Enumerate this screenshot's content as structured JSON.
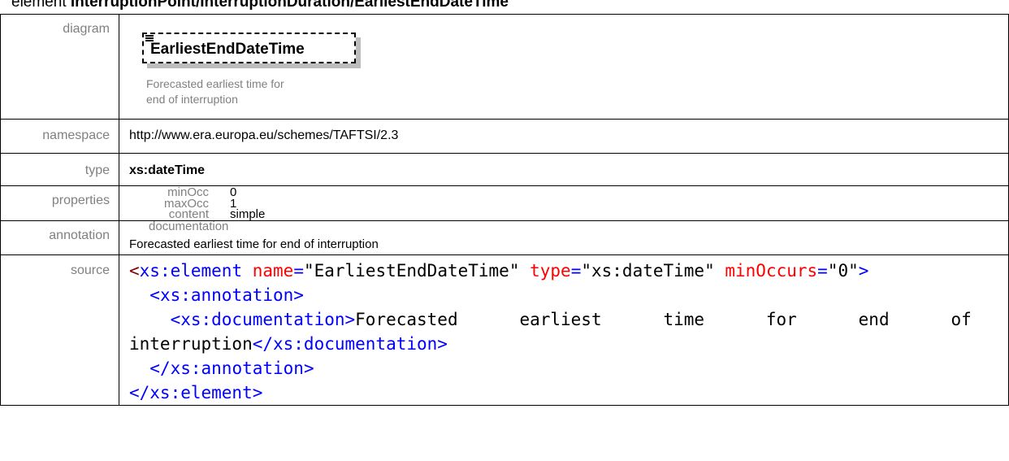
{
  "heading": {
    "prefix": "element ",
    "path": "InterruptionPoint/InterruptionDuration/EarliestEndDateTime"
  },
  "labels": {
    "diagram": "diagram",
    "namespace": "namespace",
    "type": "type",
    "properties": "properties",
    "annotation": "annotation",
    "source": "source"
  },
  "diagram": {
    "element_name": "EarliestEndDateTime",
    "doc_line1": "Forecasted earliest time for",
    "doc_line2": "end of interruption"
  },
  "namespace": "http://www.era.europa.eu/schemes/TAFTSI/2.3",
  "type": "xs:dateTime",
  "properties": [
    {
      "key": "minOcc",
      "value": "0"
    },
    {
      "key": "maxOcc",
      "value": "1"
    },
    {
      "key": "content",
      "value": "simple"
    }
  ],
  "annotation": {
    "key": "documentation",
    "value": "Forecasted earliest time for end of interruption"
  },
  "source": {
    "l1_open": "<",
    "l1_tag": "xs:element",
    "l1_attr1": " name",
    "l1_eq1": "=",
    "l1_val1": "\"EarliestEndDateTime\"",
    "l1_attr2": " type",
    "l1_eq2": "=",
    "l1_val2": "\"xs:dateTime\"",
    "l1_attr3": " minOccurs",
    "l1_eq3": "=",
    "l1_val3": "\"0\"",
    "l1_close": ">",
    "l2_tag": "<xs:annotation>",
    "l3_tag": "<xs:documentation>",
    "l3_text": "Forecasted      earliest      time      for      end      of",
    "l4_text": "interruption",
    "l4_tag": "</xs:documentation>",
    "l5_tag": "</xs:annotation>",
    "l6_tag": "</xs:element>"
  }
}
